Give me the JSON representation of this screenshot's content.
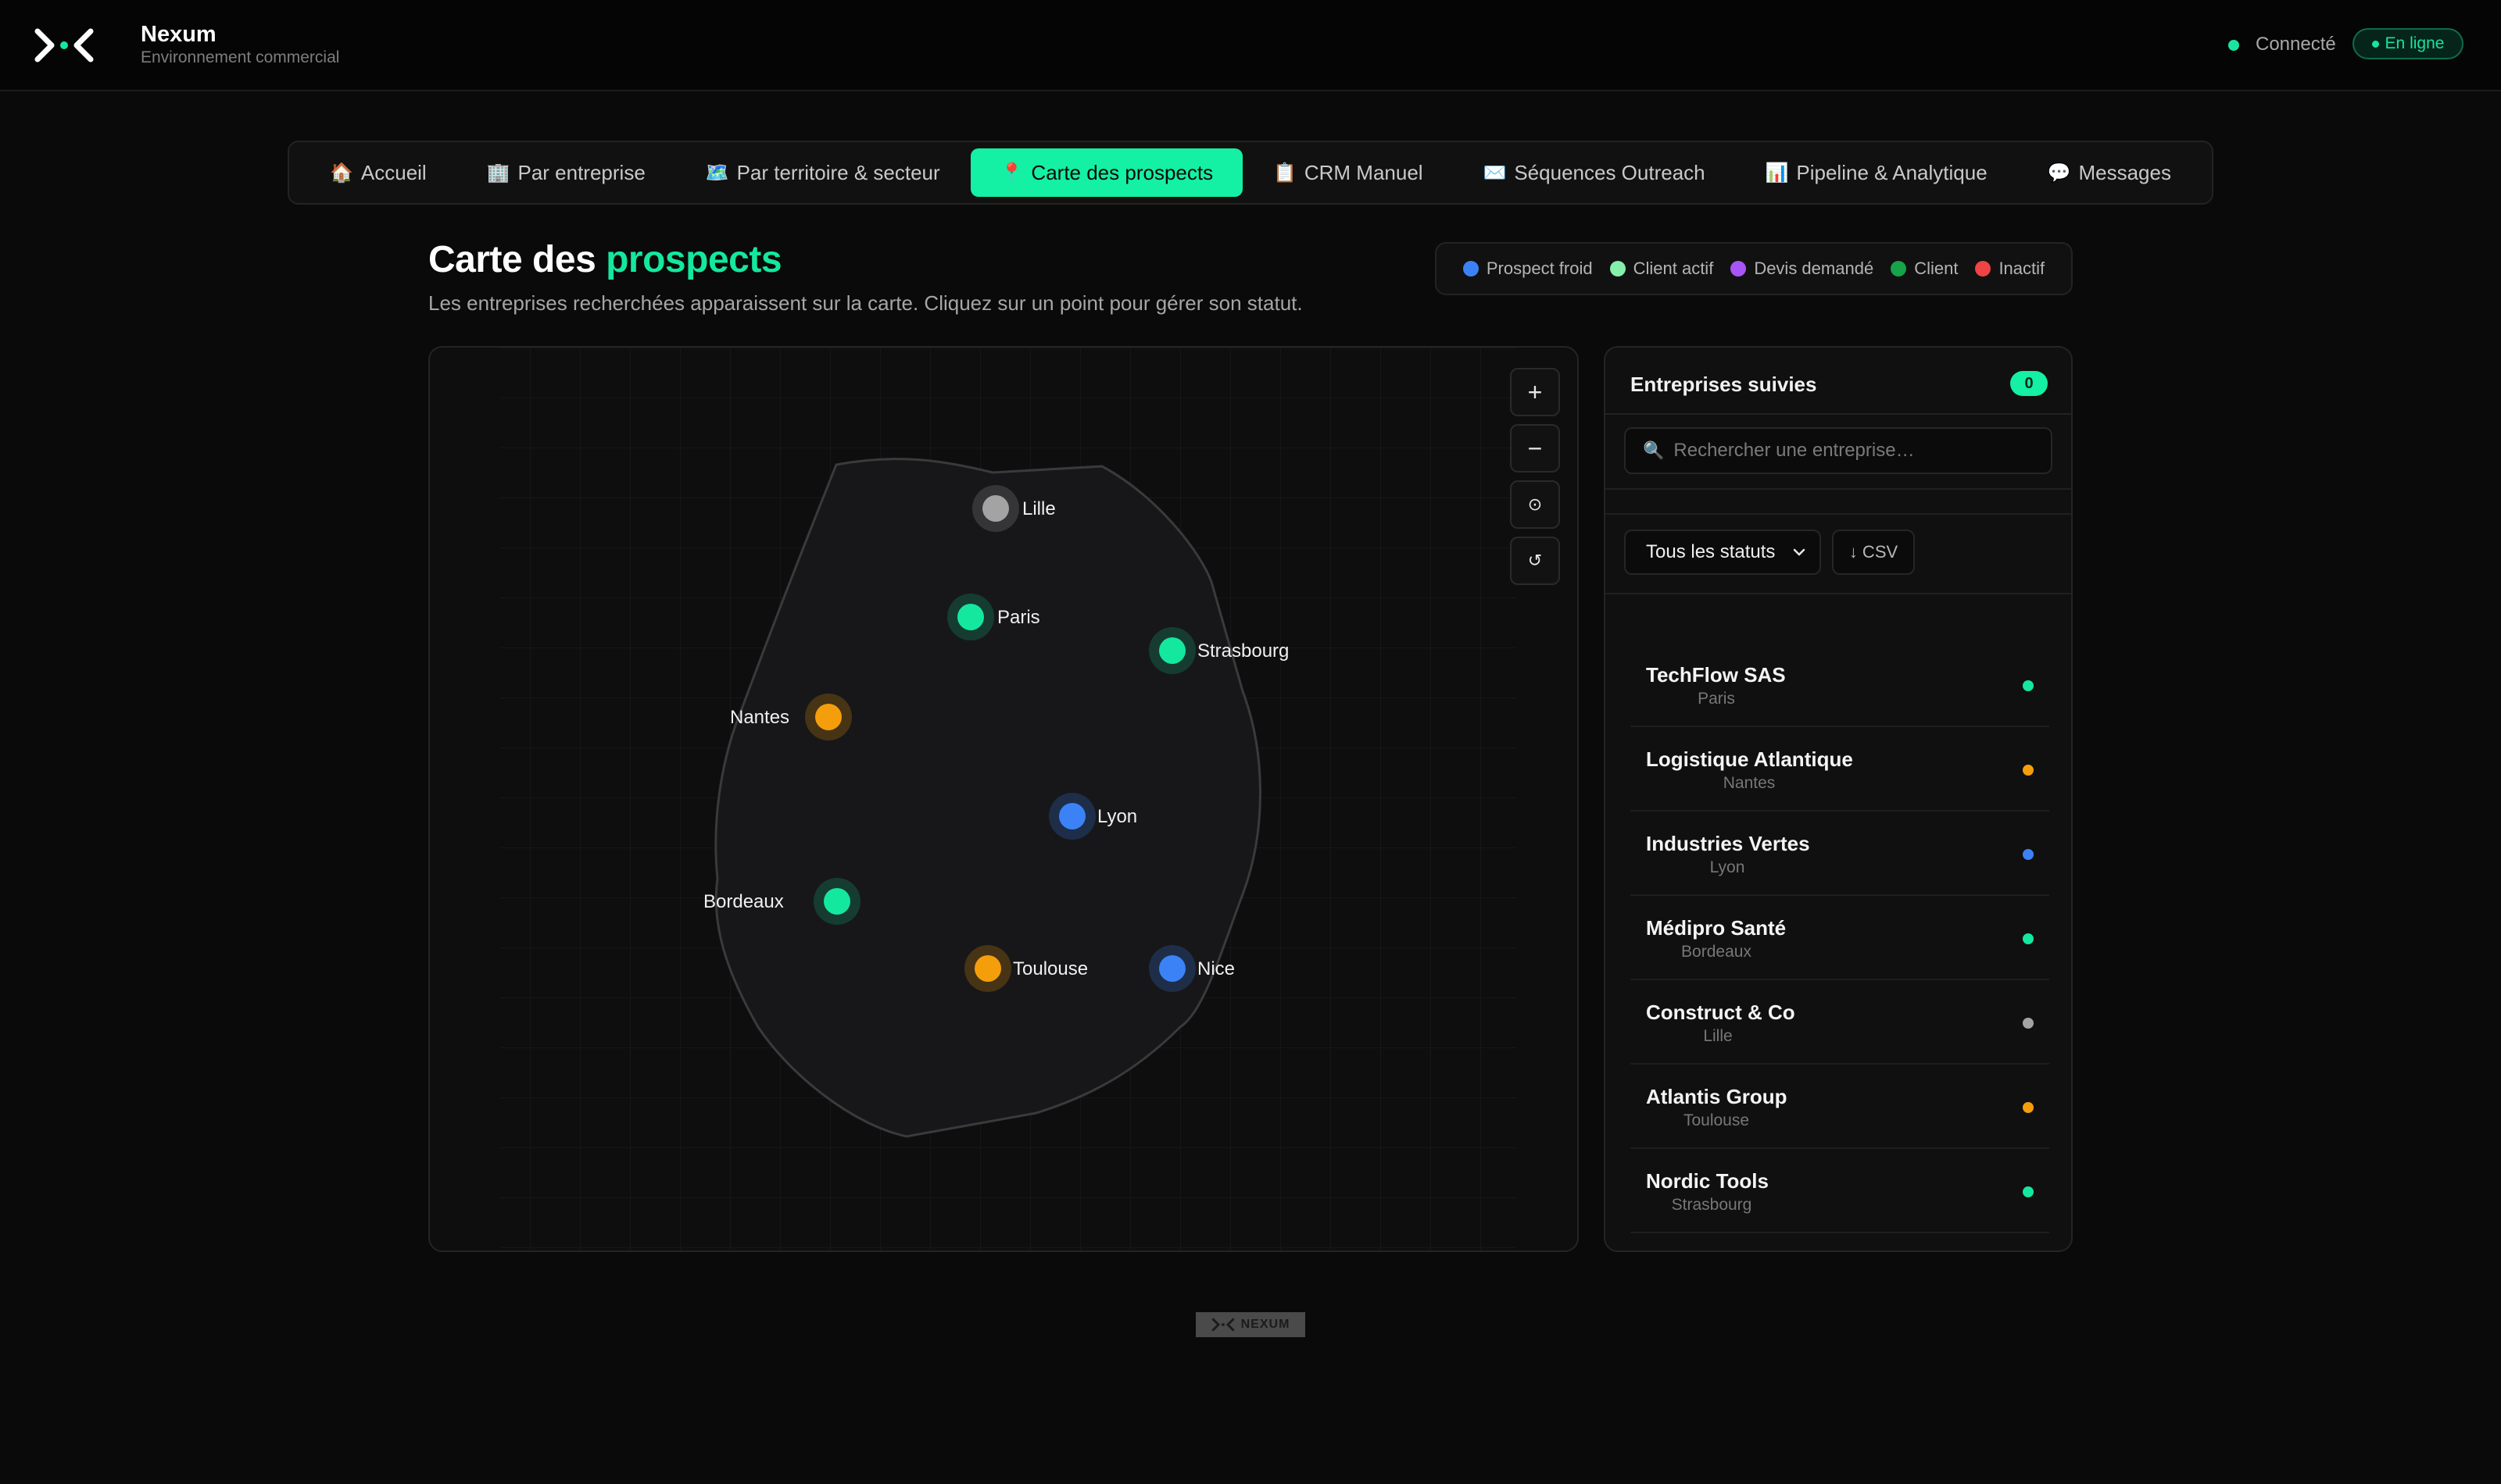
{
  "app": {
    "name": "Nexum",
    "subtitle": "Environnement commercial"
  },
  "status": {
    "connection_label": "Connecté",
    "online_label": "En ligne",
    "online_color": "#19e3a0"
  },
  "tabs": [
    {
      "icon": "🏠",
      "label": "Accueil",
      "active": false
    },
    {
      "icon": "🏢",
      "label": "Par entreprise",
      "active": false
    },
    {
      "icon": "🗺️",
      "label": "Par territoire & secteur",
      "active": false
    },
    {
      "icon": "📍",
      "label": "Carte des prospects",
      "active": true
    },
    {
      "icon": "📋",
      "label": "CRM Manuel",
      "active": false
    },
    {
      "icon": "✉️",
      "label": "Séquences Outreach",
      "active": false
    },
    {
      "icon": "📊",
      "label": "Pipeline & Analytique",
      "active": false
    },
    {
      "icon": "💬",
      "label": "Messages",
      "active": false
    }
  ],
  "page": {
    "title_prefix": "Carte des ",
    "title_accent": "prospects",
    "description": "Les entreprises recherchées apparaissent sur la carte. Cliquez sur un point pour gérer son statut."
  },
  "legend": [
    {
      "label": "Prospect froid",
      "color": "#3b82f6"
    },
    {
      "label": "Client actif",
      "color": "#86efac"
    },
    {
      "label": "Devis demandé",
      "color": "#a855f7"
    },
    {
      "label": "Client",
      "color": "#16a34a"
    },
    {
      "label": "Inactif",
      "color": "#ef4444"
    }
  ],
  "map": {
    "controls": {
      "zoom_in": "+",
      "zoom_out": "−",
      "locate": "⊙",
      "reset": "↺"
    },
    "cities": [
      {
        "name": "Lille",
        "color": "#a3a3a3"
      },
      {
        "name": "Paris",
        "color": "#14e89e"
      },
      {
        "name": "Strasbourg",
        "color": "#14e89e"
      },
      {
        "name": "Nantes",
        "color": "#f59e0b"
      },
      {
        "name": "Lyon",
        "color": "#3b82f6"
      },
      {
        "name": "Bordeaux",
        "color": "#14e89e"
      },
      {
        "name": "Toulouse",
        "color": "#f59e0b"
      },
      {
        "name": "Nice",
        "color": "#3b82f6"
      }
    ]
  },
  "sidebar": {
    "title": "Entreprises suivies",
    "count": "0",
    "search_placeholder": "Rechercher une entreprise…",
    "filter_value": "Tous les statuts",
    "csv_label": "↓ CSV",
    "companies": [
      {
        "name": "TechFlow SAS",
        "city": "Paris",
        "color": "#14e89e"
      },
      {
        "name": "Logistique Atlantique",
        "city": "Nantes",
        "color": "#f59e0b"
      },
      {
        "name": "Industries Vertes",
        "city": "Lyon",
        "color": "#3b82f6"
      },
      {
        "name": "Médipro Santé",
        "city": "Bordeaux",
        "color": "#14e89e"
      },
      {
        "name": "Construct & Co",
        "city": "Lille",
        "color": "#a3a3a3"
      },
      {
        "name": "Atlantis Group",
        "city": "Toulouse",
        "color": "#f59e0b"
      },
      {
        "name": "Nordic Tools",
        "city": "Strasbourg",
        "color": "#14e89e"
      }
    ]
  },
  "footer": {
    "logo_text": "NEXUM"
  }
}
